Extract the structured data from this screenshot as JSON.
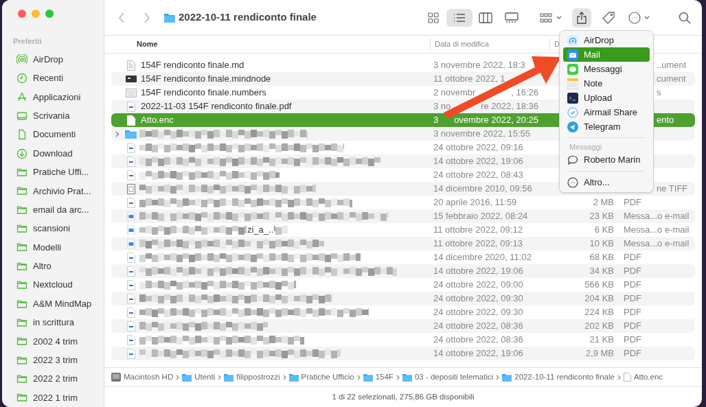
{
  "window": {
    "title": "2022-10-11 rendiconto finale"
  },
  "sidebar": {
    "section": "Preferiti",
    "items": [
      {
        "label": "AirDrop",
        "kind": "airdrop"
      },
      {
        "label": "Recenti",
        "kind": "clock"
      },
      {
        "label": "Applicazioni",
        "kind": "apps"
      },
      {
        "label": "Scrivania",
        "kind": "desktop"
      },
      {
        "label": "Documenti",
        "kind": "doc"
      },
      {
        "label": "Download",
        "kind": "download"
      },
      {
        "label": "Pratiche Uffi...",
        "kind": "folder"
      },
      {
        "label": "Archivio Prat...",
        "kind": "folder"
      },
      {
        "label": "email da arc...",
        "kind": "folder"
      },
      {
        "label": "scansioni",
        "kind": "folder"
      },
      {
        "label": "Modelli",
        "kind": "folder"
      },
      {
        "label": "Altro",
        "kind": "folder"
      },
      {
        "label": "Nextcloud",
        "kind": "folder"
      },
      {
        "label": "A&M MindMap",
        "kind": "folder"
      },
      {
        "label": "in scrittura",
        "kind": "folder"
      },
      {
        "label": "2002 4 trim",
        "kind": "folder"
      },
      {
        "label": "2022 3 trim",
        "kind": "folder"
      },
      {
        "label": "2022 2 trim",
        "kind": "folder"
      },
      {
        "label": "2022 1 trim",
        "kind": "folder"
      }
    ]
  },
  "toolbar": {
    "view_modes": [
      {
        "kind": "icons",
        "selected": false
      },
      {
        "kind": "list",
        "selected": true
      },
      {
        "kind": "columns",
        "selected": false
      },
      {
        "kind": "gallery",
        "selected": false
      }
    ]
  },
  "table": {
    "columns": [
      "Nome",
      "Data di modifica",
      "D"
    ],
    "rows": [
      {
        "kind": "text",
        "name": "154F rendiconto finale.md",
        "date": "3 novembre 2022, 18:3",
        "type_label": "..ument",
        "partial": true,
        "selected": false
      },
      {
        "kind": "mindnode",
        "name": "154F rendiconto finale.mindnode",
        "date": "11 ottobre 2022, 1",
        "type_label": "cument",
        "partial": true,
        "selected": false
      },
      {
        "kind": "numbers",
        "name": "154F rendiconto finale.numbers",
        "date": "2 novembr",
        "date_end": ", 16:26",
        "type_label": "s",
        "partial": true,
        "selected": false
      },
      {
        "kind": "pdf",
        "name": "2022-11-03 154F rendiconto finale.pdf",
        "date": "3 no",
        "date_end": "re 2022, 18:36",
        "selected": false
      },
      {
        "kind": "blank",
        "name": "Atto.enc",
        "date": "3",
        "date_end": "ovembre 2022, 20:25",
        "type_label": "ento",
        "partial": true,
        "selected": true
      },
      {
        "kind": "folder",
        "redacted": true,
        "date": "3 novembre 2022, 15:55",
        "selected": false
      },
      {
        "kind": "pdf",
        "redacted": true,
        "date": "24 ottobre 2022, 09:16",
        "selected": false
      },
      {
        "kind": "pdf",
        "redacted": true,
        "date": "14 ottobre 2022, 19:06",
        "selected": false
      },
      {
        "kind": "pdf",
        "redacted": true,
        "date": "24 ottobre 2022, 08:43",
        "selected": false
      },
      {
        "kind": "image",
        "redacted": true,
        "date": "14 dicembre 2010, 09:56",
        "type_label": "ne TIFF",
        "partial": true,
        "selected": false
      },
      {
        "kind": "pdf",
        "redacted": true,
        "date": "20 aprile 2016, 11:59",
        "size": "2 MB",
        "type_label": "PDF",
        "selected": false
      },
      {
        "kind": "mail",
        "redacted": true,
        "date": "15 febbraio 2022, 08:24",
        "size": "23 KB",
        "type_label": "Messa...o e-mail",
        "selected": false
      },
      {
        "kind": "mail",
        "redacted": true,
        "fragment": "zi_a_..",
        "date": "11 ottobre 2022, 09:12",
        "size": "6 KB",
        "type_label": "Messa...o e-mail",
        "selected": false
      },
      {
        "kind": "mail",
        "redacted": true,
        "date": "11 ottobre 2022, 09:13",
        "size": "10 KB",
        "type_label": "Messa...o e-mail",
        "selected": false
      },
      {
        "kind": "pdf",
        "redacted": true,
        "date": "14 dicembre 2020, 11:02",
        "size": "68 KB",
        "type_label": "PDF",
        "selected": false
      },
      {
        "kind": "pdf",
        "redacted": true,
        "date": "14 ottobre 2022, 19:06",
        "size": "34 KB",
        "type_label": "PDF",
        "selected": false
      },
      {
        "kind": "pdf",
        "redacted": true,
        "date": "24 ottobre 2022, 09:00",
        "size": "566 KB",
        "type_label": "PDF",
        "selected": false
      },
      {
        "kind": "pdf",
        "redacted": true,
        "date": "24 ottobre 2022, 09:30",
        "size": "204 KB",
        "type_label": "PDF",
        "selected": false
      },
      {
        "kind": "pdf",
        "redacted": true,
        "date": "24 ottobre 2022, 09:30",
        "size": "224 KB",
        "type_label": "PDF",
        "selected": false
      },
      {
        "kind": "pdf",
        "redacted": true,
        "date": "24 ottobre 2022, 08:36",
        "size": "202 KB",
        "type_label": "PDF",
        "selected": false
      },
      {
        "kind": "pdf",
        "redacted": true,
        "date": "24 ottobre 2022, 08:36",
        "size": "21 KB",
        "type_label": "PDF",
        "selected": false
      },
      {
        "kind": "pdf",
        "redacted": true,
        "date": "14 ottobre 2022, 19:06",
        "size": "2,9 MB",
        "type_label": "PDF",
        "selected": false
      }
    ]
  },
  "share_menu": {
    "items": [
      {
        "kind": "airdrop",
        "label": "AirDrop",
        "selected": false
      },
      {
        "kind": "mail",
        "label": "Mail",
        "selected": true
      },
      {
        "kind": "messages",
        "label": "Messaggi",
        "selected": false
      },
      {
        "kind": "notes",
        "label": "Note",
        "selected": false
      },
      {
        "kind": "terminal",
        "label": "Upload",
        "selected": false
      },
      {
        "kind": "airmail",
        "label": "Airmail Share",
        "selected": false
      },
      {
        "kind": "telegram",
        "label": "Telegram",
        "selected": false
      }
    ],
    "section": "Messaggi",
    "contacts": [
      "Roberto Marin"
    ],
    "more": "Altro..."
  },
  "path_bar": [
    {
      "kind": "disk",
      "label": "Macintosh HD"
    },
    {
      "kind": "folder",
      "label": "Utenti"
    },
    {
      "kind": "folder",
      "label": "filippostrozzi"
    },
    {
      "kind": "folder",
      "label": "Pratiche Ufficio"
    },
    {
      "kind": "folder",
      "label": "154F"
    },
    {
      "kind": "folder",
      "label": "03 - depositi telematici"
    },
    {
      "kind": "folder",
      "label": "2022-10-11 rendiconto finale"
    },
    {
      "kind": "file",
      "label": "Atto.enc"
    }
  ],
  "status_bar": "1 di 22 selezionati, 275,86 GB disponibili"
}
